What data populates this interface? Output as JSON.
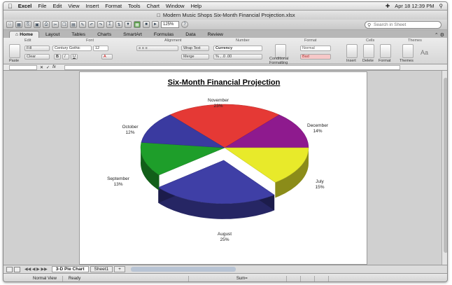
{
  "menubar": {
    "apple": "",
    "items": [
      "Excel",
      "File",
      "Edit",
      "View",
      "Insert",
      "Format",
      "Tools",
      "Chart",
      "Window",
      "Help"
    ],
    "datetime": "Apr 18  12:39 PM"
  },
  "window": {
    "title": "Modern Music Shops Six-Month Financial Projection.xlsx"
  },
  "toolbar": {
    "zoom": "125%",
    "search_placeholder": "Search in Sheet"
  },
  "ribbon": {
    "tabs": [
      "Home",
      "Layout",
      "Tables",
      "Charts",
      "SmartArt",
      "Formulas",
      "Data",
      "Review"
    ],
    "active_tab": "Home",
    "groups": [
      "Edit",
      "Font",
      "Alignment",
      "Number",
      "Format",
      "Cells",
      "Themes"
    ],
    "fill_label": "Fill",
    "clear_label": "Clear",
    "paste_label": "Paste",
    "font_name": "Century Gothic",
    "font_size": "12",
    "wrap_label": "Wrap Text",
    "merge_label": "Merge",
    "number_format": "Currency",
    "style_normal": "Normal",
    "style_bad": "Bad",
    "conditional_label": "Conditional Formatting",
    "insert_label": "Insert",
    "delete_label": "Delete",
    "format_label": "Format",
    "themes_label": "Themes"
  },
  "formula_bar": {
    "fx": "fx"
  },
  "sheet_tabs": [
    "3-D Pie Chart",
    "Sheet1"
  ],
  "active_sheet": "3-D Pie Chart",
  "status": {
    "view": "Normal View",
    "ready": "Ready",
    "sum": "Sum="
  },
  "chart_data": {
    "type": "pie",
    "title": "Six-Month Financial Projection",
    "categories": [
      "November",
      "December",
      "July",
      "August",
      "September",
      "October"
    ],
    "values": [
      23,
      14,
      15,
      25,
      13,
      12
    ],
    "labels": [
      "November\n23%",
      "December\n14%",
      "July\n15%",
      "August\n25%",
      "September\n13%",
      "October\n12%"
    ],
    "colors": [
      "#e53935",
      "#8e1a8e",
      "#e8ea2a",
      "#3f3fa6",
      "#1e9e2a",
      "#3a3aa0"
    ],
    "three_d": true,
    "exploded": [
      "August"
    ]
  }
}
